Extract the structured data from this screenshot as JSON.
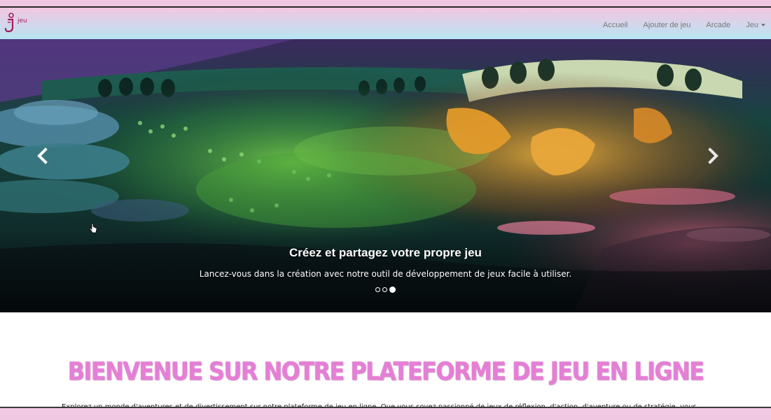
{
  "brand": {
    "name": "jeu",
    "logo_icon": "j-logo-icon"
  },
  "nav": {
    "items": [
      {
        "label": "Accueil"
      },
      {
        "label": "Ajouter de jeu"
      },
      {
        "label": "Arcade"
      },
      {
        "label": "Jeu",
        "has_dropdown": true
      }
    ]
  },
  "carousel": {
    "title": "Créez et partagez votre propre jeu",
    "text": "Lancez-vous dans la création avec notre outil de développement de jeux facile à utiliser.",
    "slide_count": 3,
    "active_slide": 3,
    "prev_icon": "chevron-left-icon",
    "next_icon": "chevron-right-icon"
  },
  "main": {
    "headline": "BIENVENUE SUR NOTRE PLATEFORME DE JEU EN LIGNE",
    "intro": "Explorez un monde d'aventures et de divertissement sur notre plateforme de jeu en ligne. Que vous soyez passionné de jeux de réflexion, d'action, d'aventure ou de stratégie, vous"
  },
  "colors": {
    "headline": "#e57fd6",
    "brand": "#a21d5b",
    "nav_text": "#7a7a7a",
    "page_frame": "#f0c8e2"
  }
}
